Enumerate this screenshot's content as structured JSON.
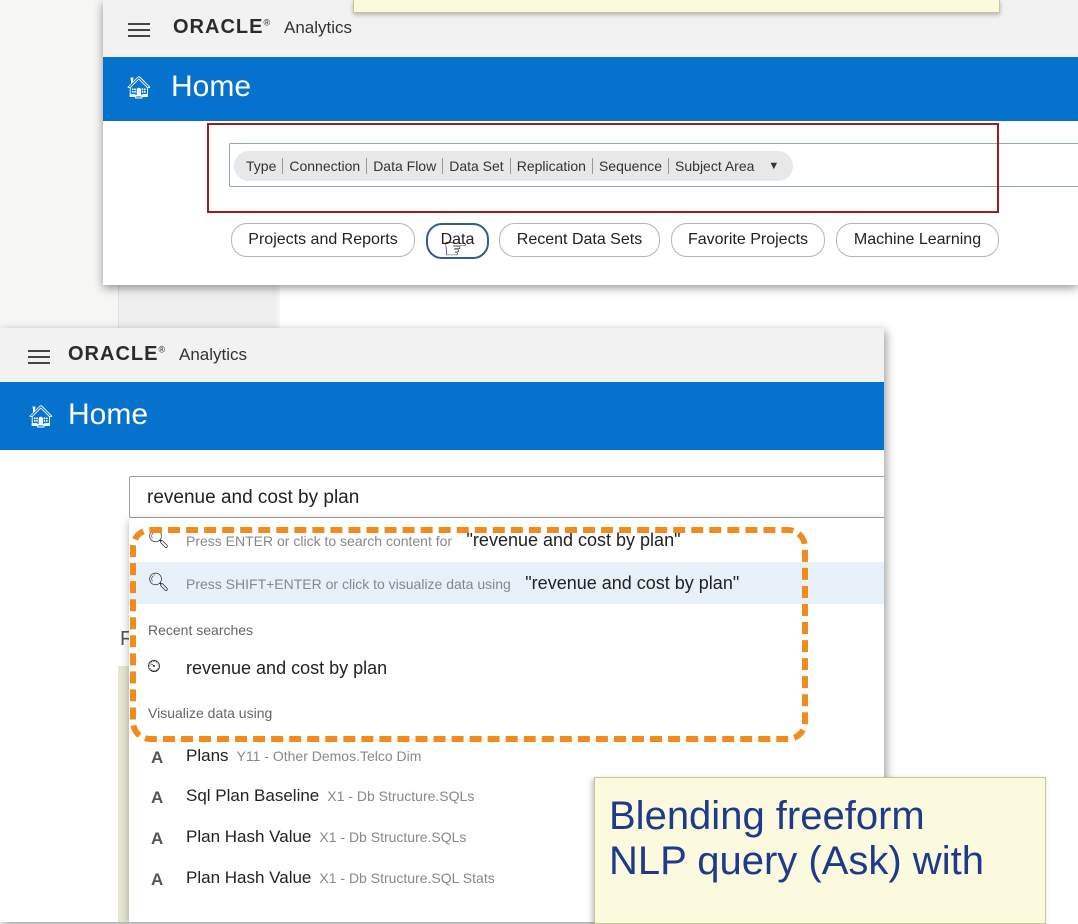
{
  "brand": {
    "oracle": "ORACLE",
    "analytics": "Analytics"
  },
  "home_title": "Home",
  "screen1": {
    "type_filters": [
      "Type",
      "Connection",
      "Data Flow",
      "Data Set",
      "Replication",
      "Sequence",
      "Subject Area"
    ],
    "tabs": [
      "Projects and Reports",
      "Data",
      "Recent Data Sets",
      "Favorite Projects",
      "Machine Learning"
    ],
    "active_tab": "Data"
  },
  "screen2": {
    "search_value": "revenue and cost by plan",
    "search_row": {
      "hint": "Press ENTER or click to search content for",
      "query": "\"revenue and cost by plan\""
    },
    "visualize_row": {
      "hint": "Press SHIFT+ENTER or click to visualize data using",
      "query": "\"revenue and cost by plan\""
    },
    "recent_label": "Recent searches",
    "recent_items": [
      "revenue and cost by plan"
    ],
    "visualize_label": "Visualize data using",
    "visualize_items": [
      {
        "name": "Plans",
        "source": "Y11 - Other Demos.Telco Dim"
      },
      {
        "name": "Sql Plan Baseline",
        "source": "X1 - Db Structure.SQLs"
      },
      {
        "name": "Plan Hash Value",
        "source": "X1 - Db Structure.SQLs"
      },
      {
        "name": "Plan Hash Value",
        "source": "X1 - Db Structure.SQL Stats"
      }
    ]
  },
  "callout": {
    "lines": [
      "Blending freeform",
      "NLP query (Ask) with"
    ]
  },
  "colors": {
    "header_blue": "#0572ce",
    "highlight_red": "#9b1c1c",
    "dash_orange": "#f28b1e",
    "note_yellow": "#fcfade",
    "note_text": "#1f3a8a"
  }
}
